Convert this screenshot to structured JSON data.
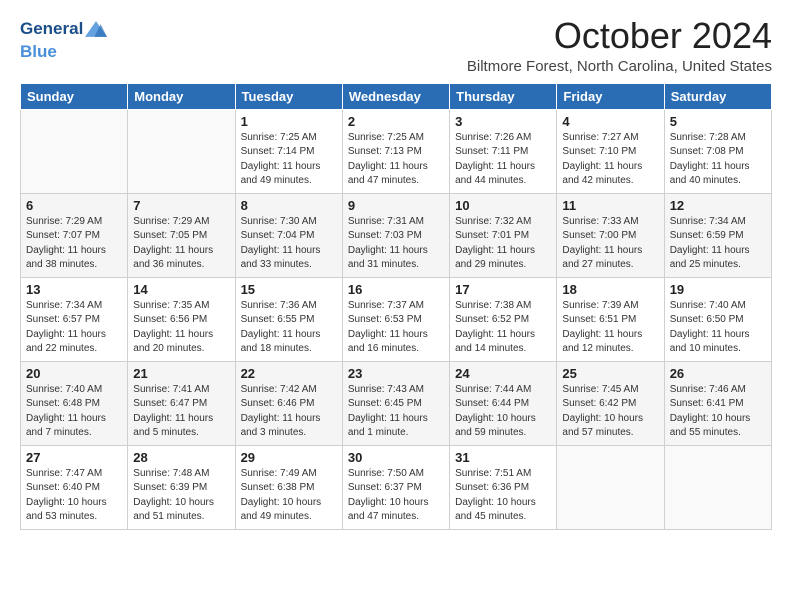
{
  "header": {
    "logo_general": "General",
    "logo_blue": "Blue",
    "month_title": "October 2024",
    "subtitle": "Biltmore Forest, North Carolina, United States"
  },
  "weekdays": [
    "Sunday",
    "Monday",
    "Tuesday",
    "Wednesday",
    "Thursday",
    "Friday",
    "Saturday"
  ],
  "weeks": [
    [
      {
        "day": "",
        "info": ""
      },
      {
        "day": "",
        "info": ""
      },
      {
        "day": "1",
        "info": "Sunrise: 7:25 AM\nSunset: 7:14 PM\nDaylight: 11 hours and 49 minutes."
      },
      {
        "day": "2",
        "info": "Sunrise: 7:25 AM\nSunset: 7:13 PM\nDaylight: 11 hours and 47 minutes."
      },
      {
        "day": "3",
        "info": "Sunrise: 7:26 AM\nSunset: 7:11 PM\nDaylight: 11 hours and 44 minutes."
      },
      {
        "day": "4",
        "info": "Sunrise: 7:27 AM\nSunset: 7:10 PM\nDaylight: 11 hours and 42 minutes."
      },
      {
        "day": "5",
        "info": "Sunrise: 7:28 AM\nSunset: 7:08 PM\nDaylight: 11 hours and 40 minutes."
      }
    ],
    [
      {
        "day": "6",
        "info": "Sunrise: 7:29 AM\nSunset: 7:07 PM\nDaylight: 11 hours and 38 minutes."
      },
      {
        "day": "7",
        "info": "Sunrise: 7:29 AM\nSunset: 7:05 PM\nDaylight: 11 hours and 36 minutes."
      },
      {
        "day": "8",
        "info": "Sunrise: 7:30 AM\nSunset: 7:04 PM\nDaylight: 11 hours and 33 minutes."
      },
      {
        "day": "9",
        "info": "Sunrise: 7:31 AM\nSunset: 7:03 PM\nDaylight: 11 hours and 31 minutes."
      },
      {
        "day": "10",
        "info": "Sunrise: 7:32 AM\nSunset: 7:01 PM\nDaylight: 11 hours and 29 minutes."
      },
      {
        "day": "11",
        "info": "Sunrise: 7:33 AM\nSunset: 7:00 PM\nDaylight: 11 hours and 27 minutes."
      },
      {
        "day": "12",
        "info": "Sunrise: 7:34 AM\nSunset: 6:59 PM\nDaylight: 11 hours and 25 minutes."
      }
    ],
    [
      {
        "day": "13",
        "info": "Sunrise: 7:34 AM\nSunset: 6:57 PM\nDaylight: 11 hours and 22 minutes."
      },
      {
        "day": "14",
        "info": "Sunrise: 7:35 AM\nSunset: 6:56 PM\nDaylight: 11 hours and 20 minutes."
      },
      {
        "day": "15",
        "info": "Sunrise: 7:36 AM\nSunset: 6:55 PM\nDaylight: 11 hours and 18 minutes."
      },
      {
        "day": "16",
        "info": "Sunrise: 7:37 AM\nSunset: 6:53 PM\nDaylight: 11 hours and 16 minutes."
      },
      {
        "day": "17",
        "info": "Sunrise: 7:38 AM\nSunset: 6:52 PM\nDaylight: 11 hours and 14 minutes."
      },
      {
        "day": "18",
        "info": "Sunrise: 7:39 AM\nSunset: 6:51 PM\nDaylight: 11 hours and 12 minutes."
      },
      {
        "day": "19",
        "info": "Sunrise: 7:40 AM\nSunset: 6:50 PM\nDaylight: 11 hours and 10 minutes."
      }
    ],
    [
      {
        "day": "20",
        "info": "Sunrise: 7:40 AM\nSunset: 6:48 PM\nDaylight: 11 hours and 7 minutes."
      },
      {
        "day": "21",
        "info": "Sunrise: 7:41 AM\nSunset: 6:47 PM\nDaylight: 11 hours and 5 minutes."
      },
      {
        "day": "22",
        "info": "Sunrise: 7:42 AM\nSunset: 6:46 PM\nDaylight: 11 hours and 3 minutes."
      },
      {
        "day": "23",
        "info": "Sunrise: 7:43 AM\nSunset: 6:45 PM\nDaylight: 11 hours and 1 minute."
      },
      {
        "day": "24",
        "info": "Sunrise: 7:44 AM\nSunset: 6:44 PM\nDaylight: 10 hours and 59 minutes."
      },
      {
        "day": "25",
        "info": "Sunrise: 7:45 AM\nSunset: 6:42 PM\nDaylight: 10 hours and 57 minutes."
      },
      {
        "day": "26",
        "info": "Sunrise: 7:46 AM\nSunset: 6:41 PM\nDaylight: 10 hours and 55 minutes."
      }
    ],
    [
      {
        "day": "27",
        "info": "Sunrise: 7:47 AM\nSunset: 6:40 PM\nDaylight: 10 hours and 53 minutes."
      },
      {
        "day": "28",
        "info": "Sunrise: 7:48 AM\nSunset: 6:39 PM\nDaylight: 10 hours and 51 minutes."
      },
      {
        "day": "29",
        "info": "Sunrise: 7:49 AM\nSunset: 6:38 PM\nDaylight: 10 hours and 49 minutes."
      },
      {
        "day": "30",
        "info": "Sunrise: 7:50 AM\nSunset: 6:37 PM\nDaylight: 10 hours and 47 minutes."
      },
      {
        "day": "31",
        "info": "Sunrise: 7:51 AM\nSunset: 6:36 PM\nDaylight: 10 hours and 45 minutes."
      },
      {
        "day": "",
        "info": ""
      },
      {
        "day": "",
        "info": ""
      }
    ]
  ]
}
